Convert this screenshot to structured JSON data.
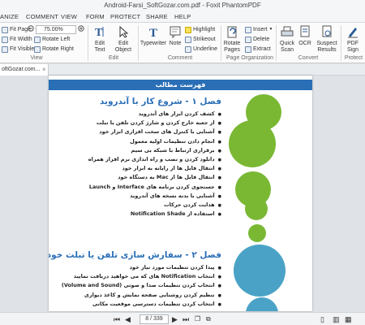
{
  "window": {
    "title": "Android-Farsi_SoftGozar.com.pdf - Foxit PhantomPDF"
  },
  "menu": [
    "ANIZE",
    "COMMENT",
    "VIEW",
    "FORM",
    "PROTECT",
    "SHARE",
    "HELP"
  ],
  "ribbon": {
    "fit_page": "Fit Page",
    "fit_width": "Fit Width",
    "fit_visible": "Fit Visible",
    "zoom": "75.00%",
    "rotate_left": "Rotate Left",
    "rotate_right": "Rotate Right",
    "view_group": "View",
    "edit_text": "Edit Text",
    "edit_object": "Edit Object",
    "edit_group": "Edit",
    "typewriter": "Typewriter",
    "note": "Note",
    "highlight": "Highlight",
    "strikeout": "Strikeout",
    "underline": "Underline",
    "comment_group": "Comment",
    "rotate_pages": "Rotate Pages",
    "insert": "Insert",
    "delete": "Delete",
    "extract": "Extract",
    "page_org_group": "Page Organization",
    "quick_scan": "Quick Scan",
    "ocr": "OCR",
    "suspect_results": "Suspect Results",
    "convert_group": "Convert",
    "pdf_sign": "PDF Sign",
    "protect_group": "Protect"
  },
  "doc_tab": "oftGozar.com...",
  "document": {
    "toc_title": "فهرست مطالب",
    "chapter1": {
      "title": "فصل ۱ - شروع کار با آندروید",
      "items": [
        "کشف کردن ابزار های آندروید",
        "از جعبه خارج کردن و شارژ کردن تلفن یا تبلت",
        "آشنایی با کنترل های سخت افزاری ابزار خود",
        "انجام دادن تنظیمات اولیه معمول",
        "برقراری ارتباط با شبکه بی سیم",
        "دانلود کردن و نصب و راه اندازی نرم افزار همراه",
        "انتقال فایل ها از رایانه به ابزار خود",
        "انتقال فایل ها از Mac به دستگاه خود",
        "جستجوی کردن برنامه های Interface و Launch",
        "آشنایی با بدنه نسخه های آندروید",
        "هدایت کردن حرکات",
        "استفاده از Notification Shade"
      ]
    },
    "chapter2": {
      "title": "فصل ۲ - سفارش سازی تلفن یا تبلت خود",
      "items": [
        "پیدا کردن تنظیمات مورد نیاز خود",
        "انتخاب Notification های که می خواهید دریافت نمایید",
        "انتخاب کردن تنظیمات صدا و صوتی (Volume and Sound)",
        "تنظیم کردن روشنایی صفحه نمایش و کاغذ دیواری",
        "انتخاب کردن تنظیمات دسترسی موقعیت مکانی"
      ]
    }
  },
  "status": {
    "page": "8 / 339"
  },
  "colors": {
    "accent": "#2a6fb6",
    "green": "#7ab834",
    "teal": "#4aa3c6"
  }
}
